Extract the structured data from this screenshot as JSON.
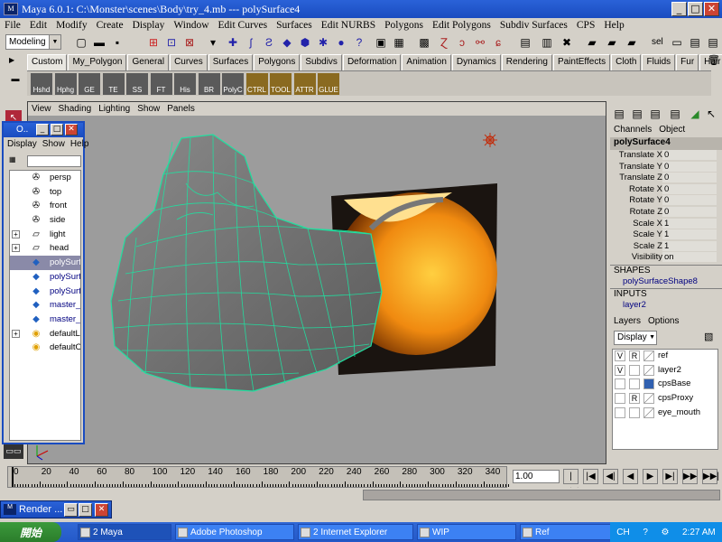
{
  "window": {
    "title": "Maya 6.0.1: C:\\Monster\\scenes\\Body\\try_4.mb   ---   polySurface4",
    "min": "_",
    "max": "□",
    "close": "✕"
  },
  "menubar": [
    "File",
    "Edit",
    "Modify",
    "Create",
    "Display",
    "Window",
    "Edit Curves",
    "Surfaces",
    "Edit NURBS",
    "Polygons",
    "Edit Polygons",
    "Subdiv Surfaces",
    "CPS",
    "Help"
  ],
  "toolbar": {
    "mode": "Modeling",
    "sel_label": "sel"
  },
  "shelf_tabs": [
    "Custom",
    "My_Polygon",
    "General",
    "Curves",
    "Surfaces",
    "Polygons",
    "Subdivs",
    "Deformation",
    "Animation",
    "Dynamics",
    "Rendering",
    "PaintEffects",
    "Cloth",
    "Fluids",
    "Fur",
    "Hair"
  ],
  "shelf_items": [
    "Hshd",
    "Hphg",
    "GE",
    "TE",
    "SS",
    "FT",
    "His",
    "BR",
    "PolyC",
    "CTRL",
    "TOOL",
    "ATTR",
    "GLUE"
  ],
  "viewport_menu": [
    "View",
    "Shading",
    "Lighting",
    "Show",
    "Panels"
  ],
  "outliner": {
    "title": "O..",
    "menu": [
      "Display",
      "Show",
      "Help"
    ],
    "items": [
      {
        "label": "persp",
        "icon": "camera-icon",
        "expand": ""
      },
      {
        "label": "top",
        "icon": "camera-icon",
        "expand": ""
      },
      {
        "label": "front",
        "icon": "camera-icon",
        "expand": ""
      },
      {
        "label": "side",
        "icon": "camera-icon",
        "expand": ""
      },
      {
        "label": "light",
        "icon": "light-icon",
        "expand": "+"
      },
      {
        "label": "head",
        "icon": "light-icon",
        "expand": "+"
      },
      {
        "label": "polySurf",
        "icon": "mesh-icon",
        "expand": "",
        "selected": true
      },
      {
        "label": "polySurf",
        "icon": "mesh-icon",
        "expand": ""
      },
      {
        "label": "polySurf",
        "icon": "mesh-icon",
        "expand": ""
      },
      {
        "label": "master_",
        "icon": "mesh-icon",
        "expand": ""
      },
      {
        "label": "master_",
        "icon": "mesh-icon",
        "expand": ""
      },
      {
        "label": "defaultL",
        "icon": "set-icon",
        "expand": "+"
      },
      {
        "label": "defaultO",
        "icon": "set-icon",
        "expand": ""
      }
    ]
  },
  "channels": {
    "header": [
      "Channels",
      "Object"
    ],
    "object": "polySurface4",
    "rows": [
      {
        "label": "Translate X",
        "value": "0"
      },
      {
        "label": "Translate Y",
        "value": "0"
      },
      {
        "label": "Translate Z",
        "value": "0"
      },
      {
        "label": "Rotate X",
        "value": "0"
      },
      {
        "label": "Rotate Y",
        "value": "0"
      },
      {
        "label": "Rotate Z",
        "value": "0"
      },
      {
        "label": "Scale X",
        "value": "1"
      },
      {
        "label": "Scale Y",
        "value": "1"
      },
      {
        "label": "Scale Z",
        "value": "1"
      },
      {
        "label": "Visibility",
        "value": "on"
      }
    ],
    "shapes_label": "SHAPES",
    "shape": "polySurfaceShape8",
    "inputs_label": "INPUTS",
    "input": "layer2"
  },
  "layers": {
    "menu": [
      "Layers",
      "Options"
    ],
    "display": "Display",
    "rows": [
      {
        "v": "V",
        "r": "R",
        "name": "ref",
        "color": ""
      },
      {
        "v": "V",
        "r": "",
        "name": "layer2",
        "color": ""
      },
      {
        "v": "",
        "r": "",
        "name": "cpsBase",
        "color": "#3060b0"
      },
      {
        "v": "",
        "r": "R",
        "name": "cpsProxy",
        "color": ""
      },
      {
        "v": "",
        "r": "",
        "name": "eye_mouth",
        "color": ""
      }
    ]
  },
  "timeline": {
    "ticks": [
      "0",
      "20",
      "40",
      "60",
      "80",
      "100",
      "120",
      "140",
      "160",
      "180",
      "200",
      "220",
      "240",
      "260",
      "280",
      "300",
      "320",
      "340"
    ],
    "current_frame": "1.00"
  },
  "render_window": {
    "title": "Render ..."
  },
  "taskbar": {
    "start": "開始",
    "tasks": [
      {
        "label": "2 Maya",
        "active": true
      },
      {
        "label": "Adobe Photoshop",
        "active": false
      },
      {
        "label": "2 Internet Explorer",
        "active": false
      },
      {
        "label": "WIP",
        "active": false
      },
      {
        "label": "Ref",
        "active": false
      }
    ],
    "lang": "CH",
    "time": "2:27 AM"
  },
  "colors": {
    "wireframe": "#20e0a0",
    "title_blue": "#1a4cc0",
    "viewport_bg": "#9c9c9c"
  }
}
